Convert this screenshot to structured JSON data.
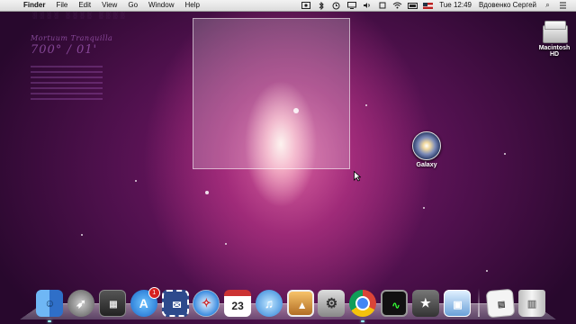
{
  "menubar": {
    "apple_glyph": "",
    "app_name": "Finder",
    "menus": [
      "File",
      "Edit",
      "View",
      "Go",
      "Window",
      "Help"
    ],
    "clock": "Tue 12:49",
    "user": "Вдовенко Сергей",
    "search_glyph": "⌕"
  },
  "wallpaper_text": {
    "title": "Mortuum Tranquilla",
    "coords": "700° / 01'"
  },
  "desktop": {
    "hd_label_line1": "Macintosh",
    "hd_label_line2": "HD",
    "galaxy_label": "Galaxy"
  },
  "dock": {
    "calendar_day": "23",
    "appstore_badge": "1",
    "items": [
      "finder-icon",
      "launchpad-icon",
      "dashboard-icon",
      "app-store-icon",
      "mail-stamp-icon",
      "safari-icon",
      "ical-icon",
      "itunes-icon",
      "iphoto-icon",
      "system-preferences-icon",
      "chrome-icon",
      "activity-monitor-icon",
      "imovie-icon",
      "preview-icon",
      "documents-stack-icon",
      "trash-icon"
    ]
  },
  "colors": {
    "menubar": "#e6e6e6",
    "wallpaper_core": "#ffd8e8",
    "wallpaper_mid": "#c2388a",
    "wallpaper_edge": "#24072a",
    "badge": "#d62020"
  }
}
